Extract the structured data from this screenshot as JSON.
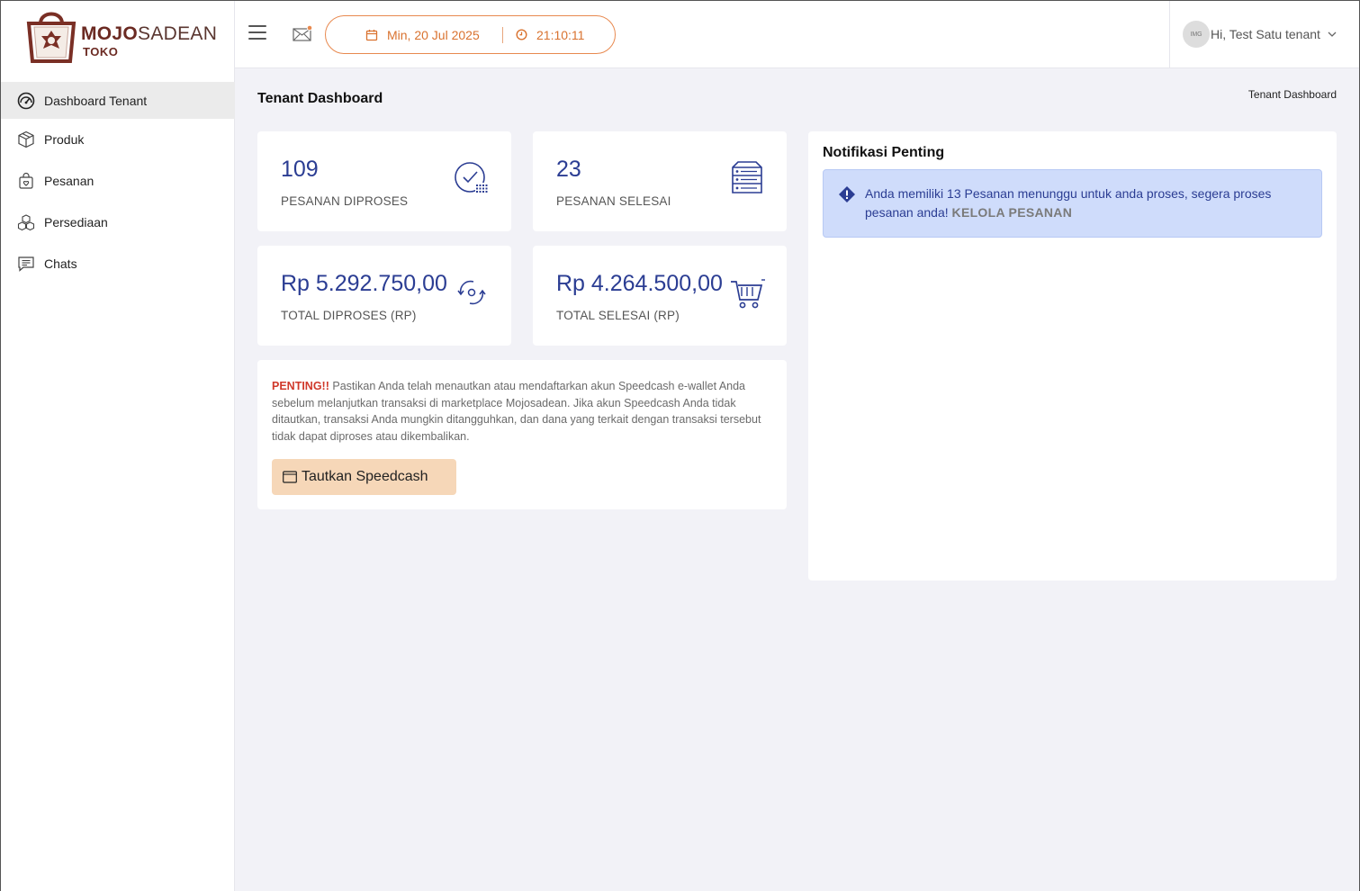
{
  "brand": {
    "name_part1": "MOJO",
    "name_part2": "SADEAN",
    "sub": "TOKO"
  },
  "sidebar": {
    "items": [
      {
        "label": "Dashboard Tenant",
        "icon": "speedometer-icon",
        "active": true
      },
      {
        "label": "Produk",
        "icon": "box-icon"
      },
      {
        "label": "Pesanan",
        "icon": "shopping-bag-icon"
      },
      {
        "label": "Persediaan",
        "icon": "boxes-icon"
      },
      {
        "label": "Chats",
        "icon": "chat-icon"
      }
    ]
  },
  "header": {
    "date": "Min, 20 Jul 2025",
    "time": "21:10:11",
    "user_greeting": "Hi, Test Satu tenant",
    "avatar_text": "IMG"
  },
  "page": {
    "title": "Tenant Dashboard",
    "breadcrumb": "Tenant Dashboard"
  },
  "stats": [
    {
      "value": "109",
      "label": "PESANAN DIPROSES",
      "icon": "check-clock-icon"
    },
    {
      "value": "23",
      "label": "PESANAN SELESAI",
      "icon": "server-icon"
    },
    {
      "value": "Rp 5.292.750,00",
      "label": "TOTAL DIPROSES (RP)",
      "icon": "refresh-icon"
    },
    {
      "value": "Rp 4.264.500,00",
      "label": "TOTAL SELESAI (RP)",
      "icon": "cart-icon"
    }
  ],
  "warning": {
    "prefix": "PENTING!!",
    "text": " Pastikan Anda telah menautkan atau mendaftarkan akun Speedcash e-wallet Anda sebelum melanjutkan transaksi di marketplace Mojosadean. Jika akun Speedcash Anda tidak ditautkan, transaksi Anda mungkin ditangguhkan, dan dana yang terkait dengan transaksi tersebut tidak dapat diproses atau dikembalikan.",
    "button": "Tautkan Speedcash"
  },
  "notifications": {
    "title": "Notifikasi Penting",
    "message": "Anda memiliki 13 Pesanan menunggu untuk anda proses, segera proses pesanan anda! ",
    "link": "KELOLA PESANAN"
  },
  "colors": {
    "accent_blue": "#2b3d93",
    "accent_orange": "#d9722f",
    "danger": "#d0392b",
    "brand": "#6b2a22"
  }
}
